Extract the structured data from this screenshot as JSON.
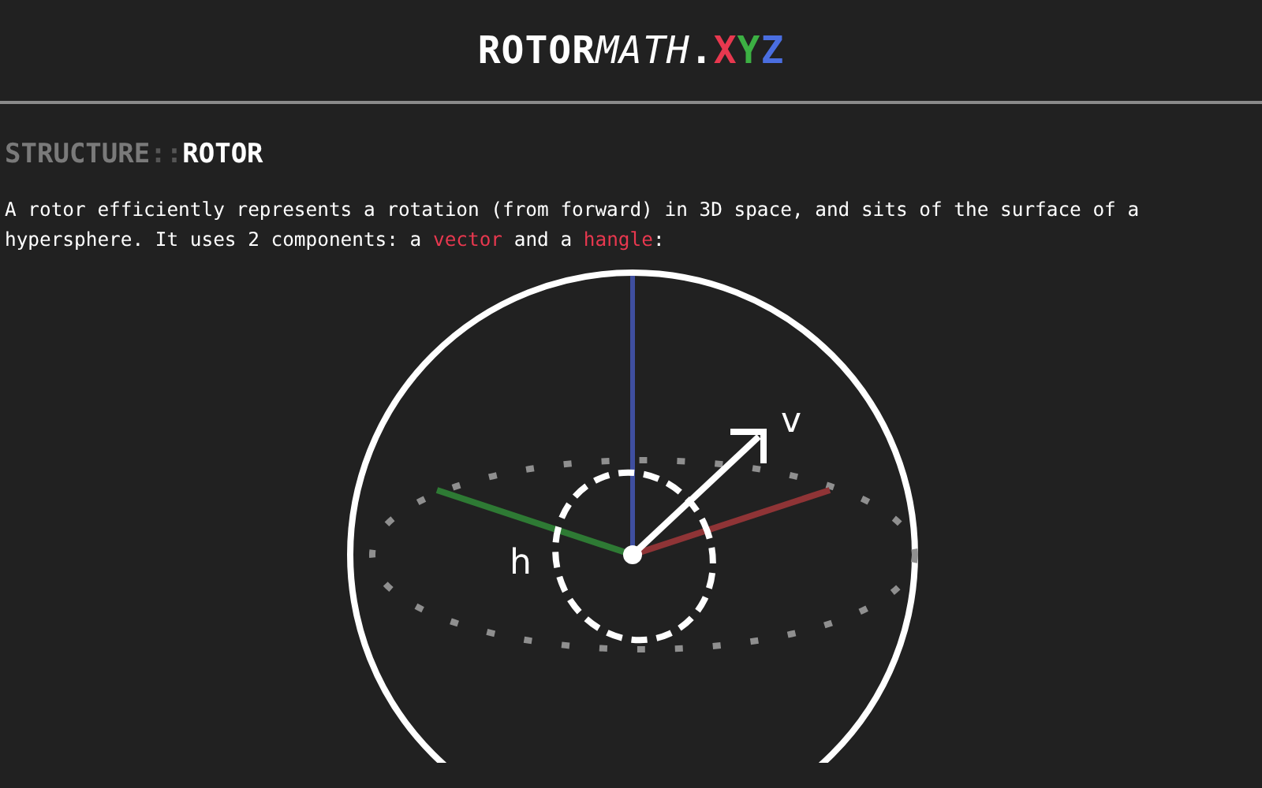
{
  "logo": {
    "parts": [
      {
        "text": "ROTOR",
        "kind": "bold",
        "color": "#ffffff"
      },
      {
        "text": "MATH",
        "kind": "italic",
        "color": "#ffffff"
      },
      {
        "text": ".",
        "kind": "bold",
        "color": "#ffffff"
      },
      {
        "text": "X",
        "kind": "bold",
        "color": "#e8384f"
      },
      {
        "text": "Y",
        "kind": "bold",
        "color": "#3cb043"
      },
      {
        "text": "Z",
        "kind": "bold",
        "color": "#4a6ee0"
      }
    ]
  },
  "heading": {
    "parts": [
      {
        "text": "STRUCTURE",
        "color": "#7a7a7a"
      },
      {
        "text": "::",
        "color": "#555555"
      },
      {
        "text": "ROTOR",
        "color": "#ffffff"
      }
    ]
  },
  "paragraph": [
    {
      "text": "A rotor efficiently represents a rotation (from forward) in 3D space, and sits of the surface of a hypersphere. It uses 2 components: a ",
      "highlight": false
    },
    {
      "text": "vector",
      "highlight": true
    },
    {
      "text": " and a ",
      "highlight": false
    },
    {
      "text": "hangle",
      "highlight": true
    },
    {
      "text": ":",
      "highlight": false
    }
  ],
  "diagram": {
    "vector_label": "v",
    "hangle_label": "h"
  }
}
